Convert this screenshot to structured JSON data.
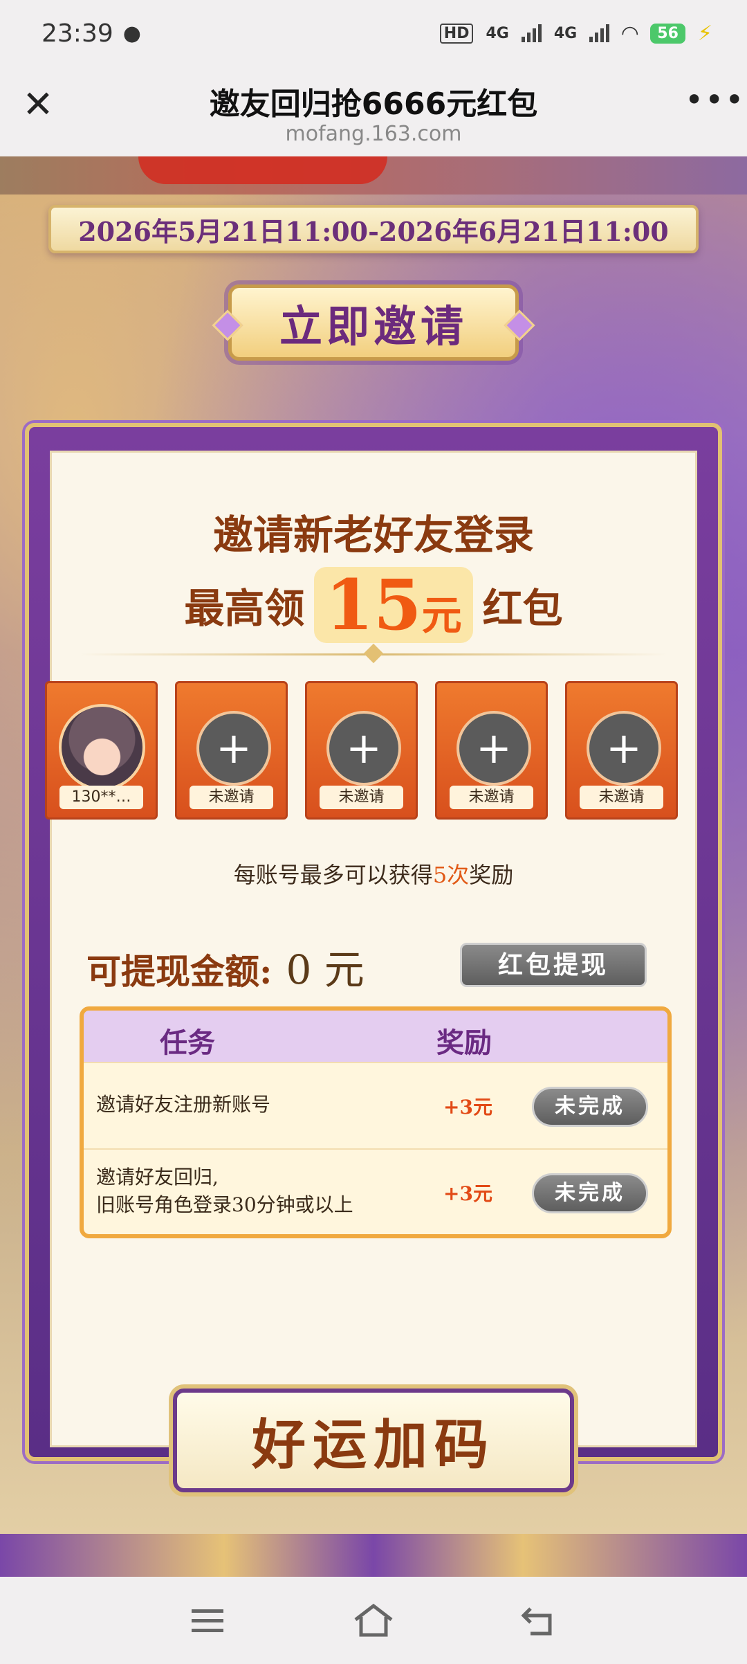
{
  "status": {
    "time": "23:39",
    "hd": "HD",
    "net1": "4G",
    "net2": "4G",
    "battery": "56"
  },
  "browser": {
    "title": "邀友回归抢6666元红包",
    "url": "mofang.163.com"
  },
  "event": {
    "period": "2026年5月21日11:00-2026年6月21日11:00",
    "invite_button": "立即邀请"
  },
  "card": {
    "headline": "邀请新老好友登录",
    "sub_prefix": "最高领",
    "sub_amount": "15",
    "sub_unit": "元",
    "sub_suffix": "红包",
    "slots": [
      {
        "label": "130**…",
        "state": "invited"
      },
      {
        "label": "未邀请",
        "state": "empty"
      },
      {
        "label": "未邀请",
        "state": "empty"
      },
      {
        "label": "未邀请",
        "state": "empty"
      },
      {
        "label": "未邀请",
        "state": "empty"
      }
    ],
    "note_prefix": "每账号最多可以获得",
    "note_highlight": "5次",
    "note_suffix": "奖励",
    "balance_label": "可提现金额:",
    "balance_value": "0 元",
    "withdraw_button": "红包提现"
  },
  "tasks": {
    "col_task": "任务",
    "col_reward": "奖励",
    "rows": [
      {
        "desc_line1": "邀请好友注册新账号",
        "desc_line2": "",
        "reward": "+3元",
        "status": "未完成"
      },
      {
        "desc_line1": "邀请好友回归,",
        "desc_line2": "旧账号角色登录30分钟或以上",
        "reward": "+3元",
        "status": "未完成"
      }
    ]
  },
  "luck_banner": "好运加码",
  "colors": {
    "accent_purple": "#6b2a7d",
    "accent_orange": "#f05a12",
    "brown_text": "#8a3a10"
  }
}
